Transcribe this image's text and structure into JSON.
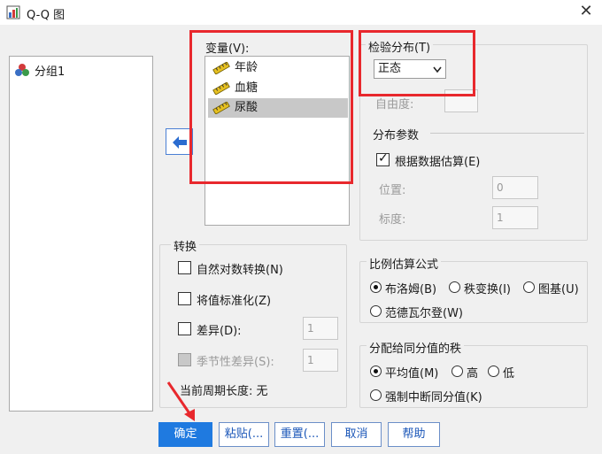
{
  "window": {
    "title": "Q-Q 图",
    "close_glyph": "✕"
  },
  "left_list": {
    "items": [
      {
        "label": "分组1",
        "icon": "nominal-variable-icon"
      }
    ]
  },
  "variables": {
    "label": "变量(V):",
    "items": [
      {
        "label": "年龄",
        "icon": "ruler-icon",
        "selected": false
      },
      {
        "label": "血糖",
        "icon": "ruler-icon",
        "selected": false
      },
      {
        "label": "尿酸",
        "icon": "ruler-icon",
        "selected": true
      }
    ]
  },
  "test_distribution": {
    "label": "检验分布(T)",
    "value": "正态",
    "df_label": "自由度:"
  },
  "distribution_params": {
    "label": "分布参数",
    "estimate_label": "根据数据估算(E)",
    "estimate_checked": true,
    "location_label": "位置:",
    "location_value": "0",
    "scale_label": "标度:",
    "scale_value": "1"
  },
  "transform": {
    "label": "转换",
    "natural_log": "自然对数转换(N)",
    "standardize": "将值标准化(Z)",
    "difference": "差异(D):",
    "difference_value": "1",
    "seasonal_difference": "季节性差异(S):",
    "seasonal_value": "1",
    "current_period": "当前周期长度: 无"
  },
  "proportion_formula": {
    "label": "比例估算公式",
    "options": [
      "布洛姆(B)",
      "秩变换(I)",
      "图基(U)",
      "范德瓦尔登(W)"
    ],
    "selected": 0
  },
  "ties": {
    "label": "分配给同分值的秩",
    "options": [
      "平均值(M)",
      "高",
      "低",
      "强制中断同分值(K)"
    ],
    "selected": 0
  },
  "buttons": {
    "ok": "确定",
    "paste": "粘贴(...",
    "reset": "重置(...",
    "cancel": "取消",
    "help": "帮助"
  },
  "colors": {
    "highlight_box": "#e8282d",
    "primary_button": "#1f7ae0",
    "annotation_arrow": "#e8282d"
  }
}
